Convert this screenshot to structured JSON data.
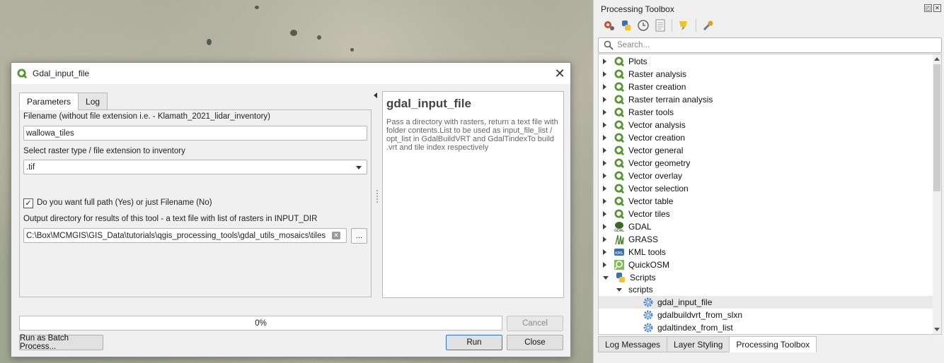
{
  "dialog": {
    "title": "Gdal_input_file",
    "close_glyph": "✕",
    "tabs": [
      "Parameters",
      "Log"
    ],
    "params": {
      "filename_label": "Filename (without file extension i.e. - Klamath_2021_lidar_inventory)",
      "filename_value": "wallowa_tiles",
      "raster_type_label": "Select raster type / file extension to inventory",
      "raster_type_value": ".tif",
      "full_path_label": "Do you want full path (Yes) or just Filename (No)",
      "full_path_checked": true,
      "check_glyph": "✓",
      "output_dir_label": "Output directory for results of this tool - a text file with list of rasters in INPUT_DIR",
      "output_dir_value": "C:\\Box\\MCMGIS\\GIS_Data\\tutorials\\qgis_processing_tools\\gdal_utils_mosaics\\tiles",
      "clear_glyph": "✕",
      "browse_label": "..."
    },
    "help": {
      "heading": "gdal_input_file",
      "text": "Pass a directory with rasters, return a text file with folder contents.List to be used as input_file_list / opt_list in GdalBuildVRT and GdalTindexTo build .vrt and tile index respectively"
    },
    "progress": {
      "value": 0,
      "label": "0%"
    },
    "buttons": {
      "cancel": "Cancel",
      "batch": "Run as Batch Process...",
      "run": "Run",
      "close": "Close"
    }
  },
  "toolbox": {
    "title": "Processing Toolbox",
    "float_glyph": "◰",
    "close_glyph": "✕",
    "search_placeholder": "Search...",
    "providers": [
      {
        "label": "Plots",
        "icon": "qgis-icon"
      },
      {
        "label": "Raster analysis",
        "icon": "qgis-icon"
      },
      {
        "label": "Raster creation",
        "icon": "qgis-icon"
      },
      {
        "label": "Raster terrain analysis",
        "icon": "qgis-icon"
      },
      {
        "label": "Raster tools",
        "icon": "qgis-icon"
      },
      {
        "label": "Vector analysis",
        "icon": "qgis-icon"
      },
      {
        "label": "Vector creation",
        "icon": "qgis-icon"
      },
      {
        "label": "Vector general",
        "icon": "qgis-icon"
      },
      {
        "label": "Vector geometry",
        "icon": "qgis-icon"
      },
      {
        "label": "Vector overlay",
        "icon": "qgis-icon"
      },
      {
        "label": "Vector selection",
        "icon": "qgis-icon"
      },
      {
        "label": "Vector table",
        "icon": "qgis-icon"
      },
      {
        "label": "Vector tiles",
        "icon": "qgis-icon"
      },
      {
        "label": "GDAL",
        "icon": "gdal-icon"
      },
      {
        "label": "GRASS",
        "icon": "grass-icon"
      },
      {
        "label": "KML tools",
        "icon": "kml-icon"
      },
      {
        "label": "QuickOSM",
        "icon": "quickosm-icon"
      },
      {
        "label": "Scripts",
        "icon": "python-icon"
      }
    ],
    "scripts_group": "scripts",
    "scripts": [
      "gdal_input_file",
      "gdalbuildvrt_from_slxn",
      "gdaltindex_from_list"
    ],
    "selected_script": "gdal_input_file"
  },
  "bottom_tabs": [
    "Log Messages",
    "Layer Styling",
    "Processing Toolbox"
  ],
  "active_bottom_tab": "Processing Toolbox",
  "colors": {
    "qgis_green": "#589632",
    "accent_blue": "#2f78d7"
  }
}
